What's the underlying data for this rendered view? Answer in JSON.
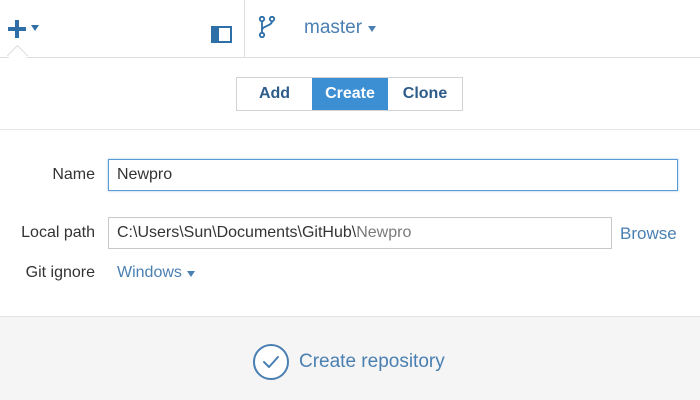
{
  "toolbar": {
    "add_icon": "plus-icon",
    "panel_icon": "panel-toggle-icon",
    "branch_icon": "branch-icon",
    "branch_name": "master"
  },
  "tabs": [
    {
      "label": "Add",
      "selected": false
    },
    {
      "label": "Create",
      "selected": true
    },
    {
      "label": "Clone",
      "selected": false
    }
  ],
  "form": {
    "name_label": "Name",
    "name_value": "Newpro",
    "path_label": "Local path",
    "path_base": "C:\\Users\\Sun\\Documents\\GitHub\\",
    "path_leaf": "Newpro",
    "browse_label": "Browse",
    "ignore_label": "Git ignore",
    "ignore_value": "Windows"
  },
  "footer": {
    "create_label": "Create repository",
    "create_icon": "check-circle-icon"
  },
  "colors": {
    "accent": "#3d8fd4",
    "link": "#4a7fb2",
    "icon": "#2e6fa8",
    "footer_bg": "#f5f5f5"
  }
}
